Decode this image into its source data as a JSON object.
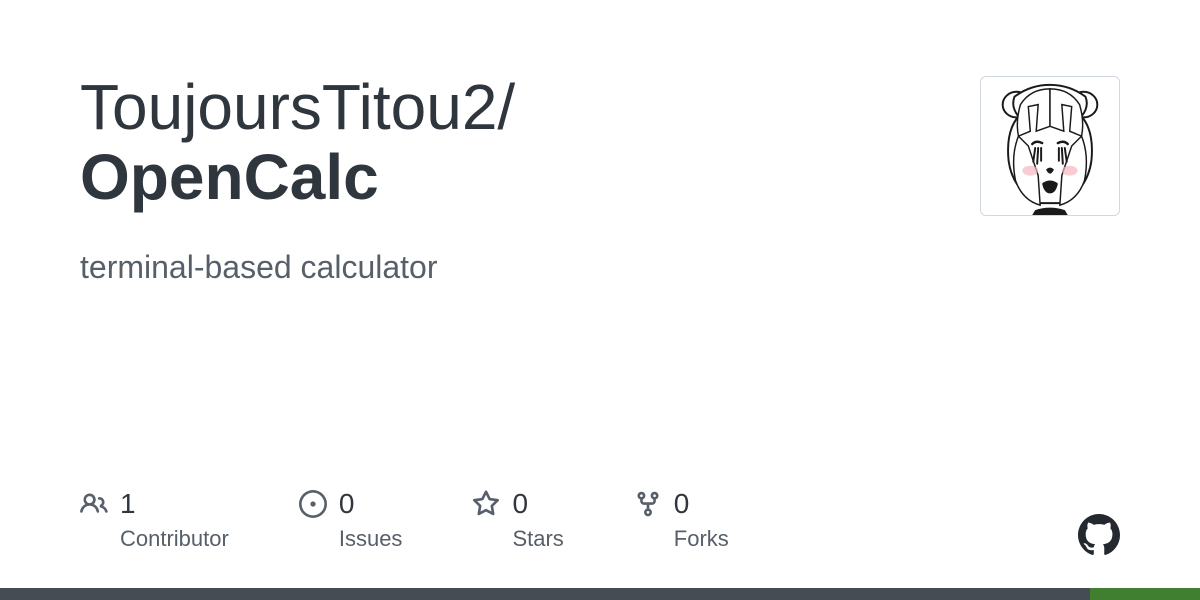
{
  "owner": "ToujoursTitou2/",
  "repo": "OpenCalc",
  "description": "terminal-based calculator",
  "stats": {
    "contributors": {
      "count": "1",
      "label": "Contributor"
    },
    "issues": {
      "count": "0",
      "label": "Issues"
    },
    "stars": {
      "count": "0",
      "label": "Stars"
    },
    "forks": {
      "count": "0",
      "label": "Forks"
    }
  }
}
